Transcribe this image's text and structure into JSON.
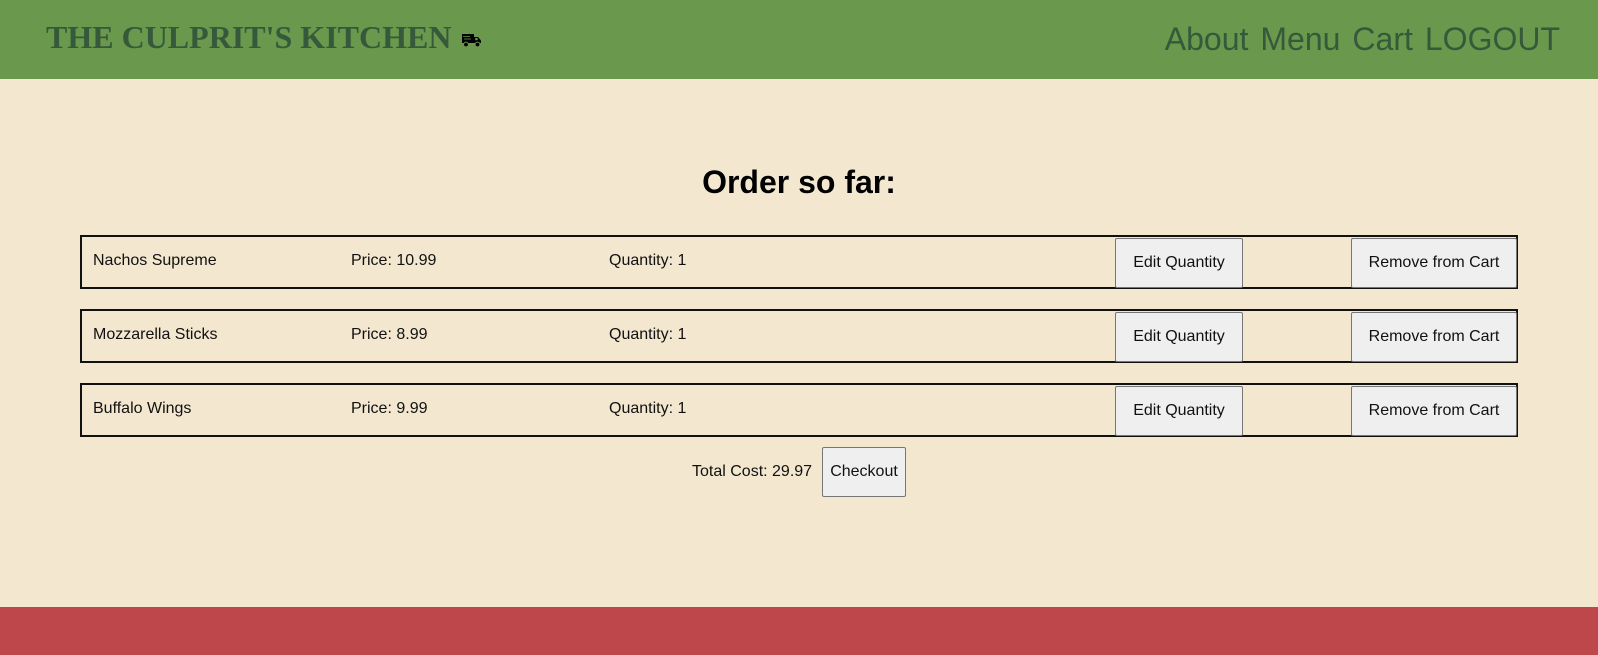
{
  "header": {
    "brand": "THE CULPRIT'S KITCHEN",
    "brand_icon": "delivery-truck-icon",
    "nav": [
      "About",
      "Menu",
      "Cart",
      "LOGOUT"
    ]
  },
  "main": {
    "title": "Order so far:",
    "items": [
      {
        "name": "Nachos Supreme",
        "price": "Price: 10.99",
        "quantity": "Quantity: 1",
        "edit_label": "Edit Quantity",
        "remove_label": "Remove from Cart"
      },
      {
        "name": "Mozzarella Sticks",
        "price": "Price: 8.99",
        "quantity": "Quantity: 1",
        "edit_label": "Edit Quantity",
        "remove_label": "Remove from Cart"
      },
      {
        "name": "Buffalo Wings",
        "price": "Price: 9.99",
        "quantity": "Quantity: 1",
        "edit_label": "Edit Quantity",
        "remove_label": "Remove from Cart"
      }
    ],
    "total": "Total Cost: 29.97",
    "checkout_label": "Checkout"
  },
  "colors": {
    "header_bg": "#6a984c",
    "header_text": "#35593a",
    "page_bg": "#f3e7cf",
    "footer_bg": "#bd474a"
  }
}
